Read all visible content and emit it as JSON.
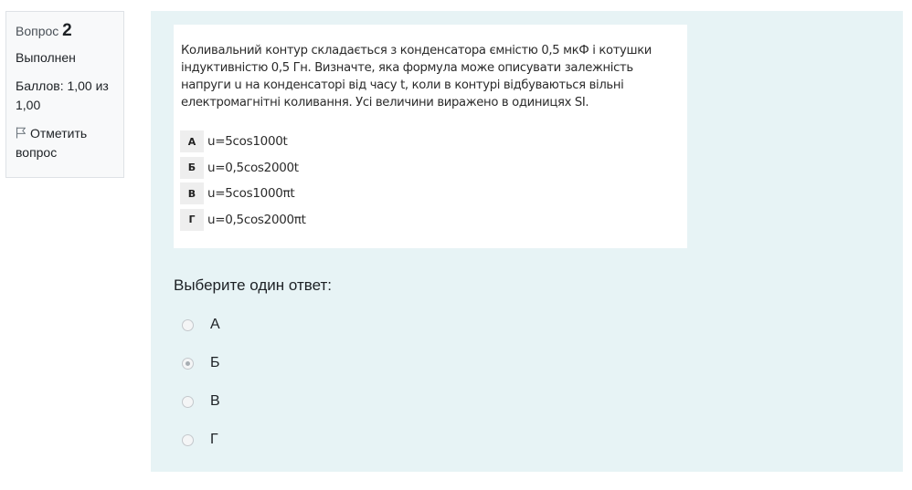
{
  "info": {
    "question_label": "Вопрос",
    "question_number": "2",
    "state": "Выполнен",
    "grade": "Баллов: 1,00 из 1,00",
    "flag_label": "Отметить вопрос"
  },
  "question": {
    "text": "Коливальний контур складається з конденсатора ємністю 0,5 мкФ і котушки індуктивністю 0,5 Гн. Визначте, яка формула може описувати залежність напруги u на конденсаторі від часу t, коли в контурі відбуваються вільні електромагнітні коливання. Усі величини виражено в одиницях SI.",
    "options": [
      {
        "letter": "А",
        "formula": "u=5cos1000t"
      },
      {
        "letter": "Б",
        "formula": "u=0,5cos2000t"
      },
      {
        "letter": "В",
        "formula": "u=5cos1000πt"
      },
      {
        "letter": "Г",
        "formula": "u=0,5cos2000πt"
      }
    ]
  },
  "prompt": "Выберите один ответ:",
  "answers": [
    {
      "label": "А",
      "checked": false
    },
    {
      "label": "Б",
      "checked": true
    },
    {
      "label": "В",
      "checked": false
    },
    {
      "label": "Г",
      "checked": false
    }
  ]
}
